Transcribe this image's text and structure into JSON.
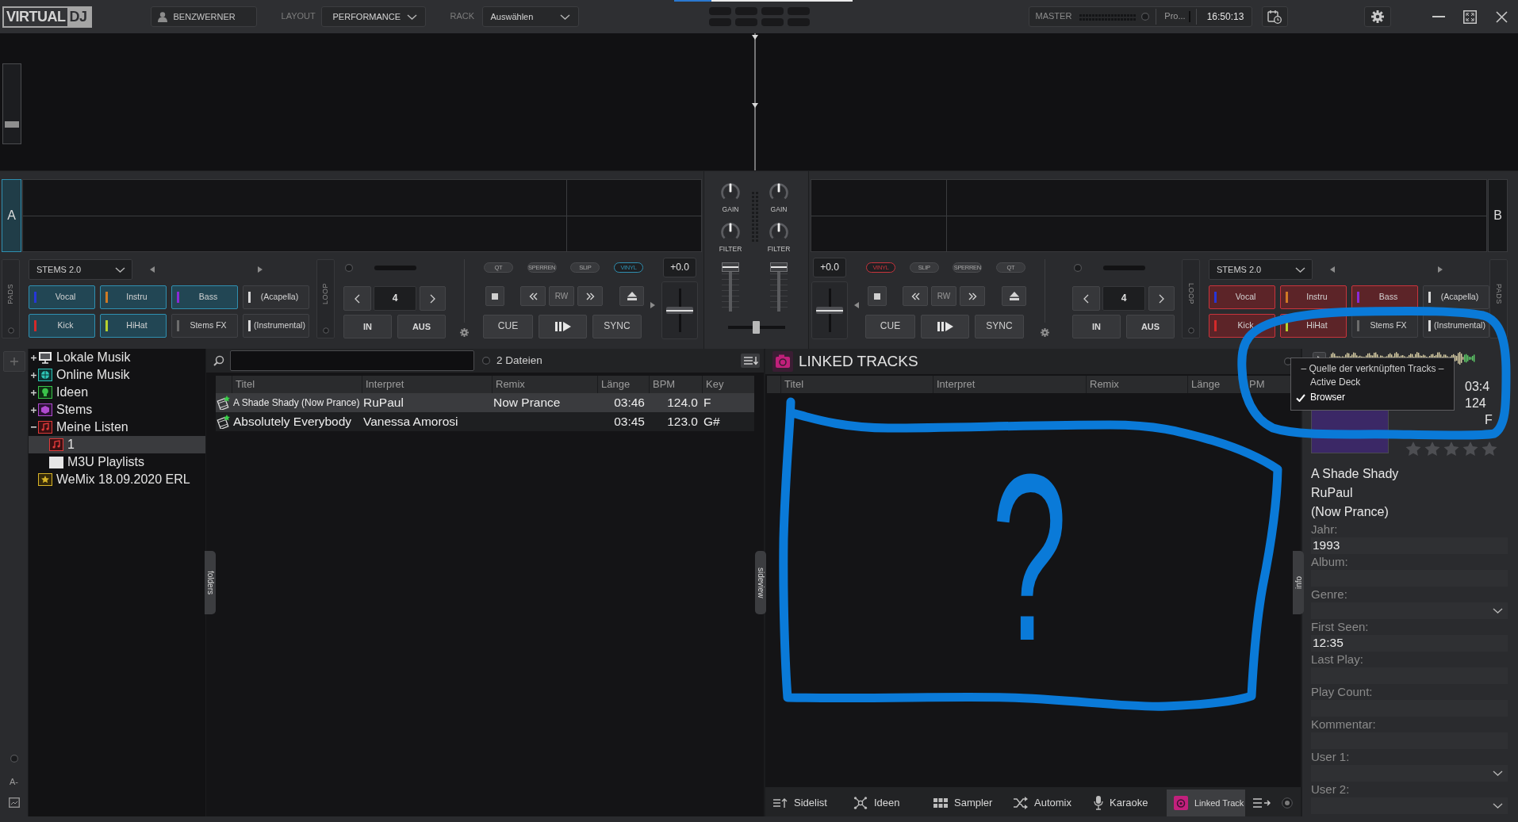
{
  "topbar": {
    "logo": {
      "text": "VIRTUAL",
      "highlight": "DJ"
    },
    "user": "BENZWERNER",
    "layout": {
      "label": "LAYOUT",
      "value": "PERFORMANCE"
    },
    "rack": {
      "label": "RACK",
      "value": "Auswählen"
    },
    "master": {
      "label": "MASTER",
      "output": "Pro...",
      "clock": "16:50:13"
    }
  },
  "overview": {
    "zoom": {
      "level": 0.22
    }
  },
  "decks": [
    {
      "label": "A",
      "active": true,
      "color": "#2f8fb0",
      "pads_label": "PADS",
      "stems_menu": "STEMS 2.0",
      "pads": [
        {
          "label": "Vocal",
          "color": "#2636d8",
          "on": true
        },
        {
          "label": "Instru",
          "color": "#d07a24",
          "on": true
        },
        {
          "label": "Bass",
          "color": "#8a2ad6",
          "on": true
        },
        {
          "label": "(Acapella)",
          "color": "#d8d8d8",
          "on": false
        },
        {
          "label": "Kick",
          "color": "#d42a2a",
          "on": true
        },
        {
          "label": "HiHat",
          "color": "#b6d12e",
          "on": true
        },
        {
          "label": "Stems FX",
          "color": "#6c6c6c",
          "on": false
        },
        {
          "label": "(Instrumental)",
          "color": "#d8d8d8",
          "on": false
        }
      ],
      "loop_label": "LOOP",
      "loop_size": "4",
      "loop_in": "IN",
      "loop_out": "AUS",
      "modes": [
        {
          "label": "QT",
          "on": false
        },
        {
          "label": "SPERREN",
          "on": false
        },
        {
          "label": "SLIP",
          "on": false
        },
        {
          "label": "VINYL",
          "on": true
        }
      ],
      "rewind": "RW",
      "cue": "CUE",
      "sync": "SYNC",
      "pitch": {
        "reading": "+0.0",
        "level": 0.5
      }
    },
    {
      "label": "B",
      "active": false,
      "color": "#c8343c",
      "pads_label": "PADS",
      "stems_menu": "STEMS 2.0",
      "pads": [
        {
          "label": "Vocal",
          "color": "#2636d8",
          "on": true
        },
        {
          "label": "Instru",
          "color": "#d07a24",
          "on": true
        },
        {
          "label": "Bass",
          "color": "#8a2ad6",
          "on": true
        },
        {
          "label": "(Acapella)",
          "color": "#d8d8d8",
          "on": false
        },
        {
          "label": "Kick",
          "color": "#d42a2a",
          "on": true
        },
        {
          "label": "HiHat",
          "color": "#b6d12e",
          "on": true
        },
        {
          "label": "Stems FX",
          "color": "#6c6c6c",
          "on": false
        },
        {
          "label": "(Instrumental)",
          "color": "#d8d8d8",
          "on": false
        }
      ],
      "loop_label": "LOOP",
      "loop_size": "4",
      "loop_in": "IN",
      "loop_out": "AUS",
      "modes": [
        {
          "label": "VINYL",
          "on": true
        },
        {
          "label": "SLIP",
          "on": false
        },
        {
          "label": "SPERREN",
          "on": false
        },
        {
          "label": "QT",
          "on": false
        }
      ],
      "rewind": "RW",
      "cue": "CUE",
      "sync": "SYNC",
      "pitch": {
        "reading": "+0.0",
        "level": 0.5
      }
    }
  ],
  "mixer": {
    "channels": [
      {
        "gain": {
          "label": "GAIN",
          "level": 0.5
        },
        "filter": {
          "label": "FILTER",
          "level": 0.5
        },
        "volume": {
          "level": 1
        }
      },
      {
        "gain": {
          "label": "GAIN",
          "level": 0.5
        },
        "filter": {
          "label": "FILTER",
          "level": 0.5
        },
        "volume": {
          "level": 1
        }
      }
    ],
    "crossfader": {
      "level": 0.5
    }
  },
  "sidebar": {
    "font_button": "A-"
  },
  "folders": {
    "tab": "folders",
    "items": [
      {
        "label": "Lokale Musik",
        "expanded": false,
        "selected": false
      },
      {
        "label": "Online Musik",
        "expanded": false,
        "selected": false
      },
      {
        "label": "Ideen",
        "expanded": false,
        "selected": false
      },
      {
        "label": "Stems",
        "expanded": false,
        "selected": false
      },
      {
        "label": "Meine Listen",
        "expanded": true,
        "selected": false,
        "children": [
          {
            "label": "1",
            "selected": true
          },
          {
            "label": "M3U Playlists",
            "selected": false
          }
        ]
      },
      {
        "label": "WeMix 18.09.2020 ERL",
        "selected": false
      }
    ]
  },
  "browser": {
    "count": "2 Dateien",
    "tab": "sideview",
    "columns": [
      "Titel",
      "Interpret",
      "Remix",
      "Länge",
      "BPM",
      "Key"
    ],
    "rows": [
      {
        "title": "A Shade Shady (Now Prance)",
        "artist": "RuPaul",
        "remix": "Now Prance",
        "length": "03:46",
        "bpm": "124.0",
        "key": "F",
        "selected": true
      },
      {
        "title": "Absolutely Everybody",
        "artist": "Vanessa Amorosi",
        "length": "03:45",
        "bpm": "123.0",
        "key": "G#",
        "selected": false
      }
    ]
  },
  "linked": {
    "title": "LINKED TRACKS",
    "columns": [
      "Titel",
      "Interpret",
      "Remix",
      "Länge",
      "PM"
    ],
    "tabs": [
      {
        "label": "Sidelist",
        "selected": false
      },
      {
        "label": "Ideen",
        "selected": false
      },
      {
        "label": "Sampler",
        "selected": false
      },
      {
        "label": "Automix",
        "selected": false
      },
      {
        "label": "Karaoke",
        "selected": false
      },
      {
        "label": "Linked Track",
        "selected": true
      }
    ]
  },
  "source_menu": {
    "title": "– Quelle der verknüpften Tracks –",
    "items": [
      {
        "label": "Active Deck",
        "selected": false
      },
      {
        "label": "Browser",
        "selected": true
      }
    ]
  },
  "info": {
    "tab": "info",
    "length": "03:4",
    "bpm": "124",
    "key": "F",
    "stars": 0,
    "title": "A Shade Shady",
    "artist": "RuPaul",
    "remix": "(Now Prance)",
    "fields": [
      {
        "label": "Jahr:",
        "value": "1993",
        "kind": "text"
      },
      {
        "label": "Album:",
        "kind": "text"
      },
      {
        "label": "Genre:",
        "kind": "dropdown"
      },
      {
        "label": "First Seen:",
        "value": "12:35",
        "kind": "text"
      },
      {
        "label": "Last Play:",
        "kind": "text"
      },
      {
        "label": "Play Count:",
        "kind": "text"
      },
      {
        "label": "Kommentar:",
        "kind": "text"
      },
      {
        "label": "User 1:",
        "kind": "dropdown"
      },
      {
        "label": "User 2:",
        "kind": "dropdown"
      }
    ]
  },
  "annotations": [
    {
      "kind": "loop"
    },
    {
      "kind": "frame"
    },
    {
      "kind": "text",
      "text": "?"
    }
  ]
}
